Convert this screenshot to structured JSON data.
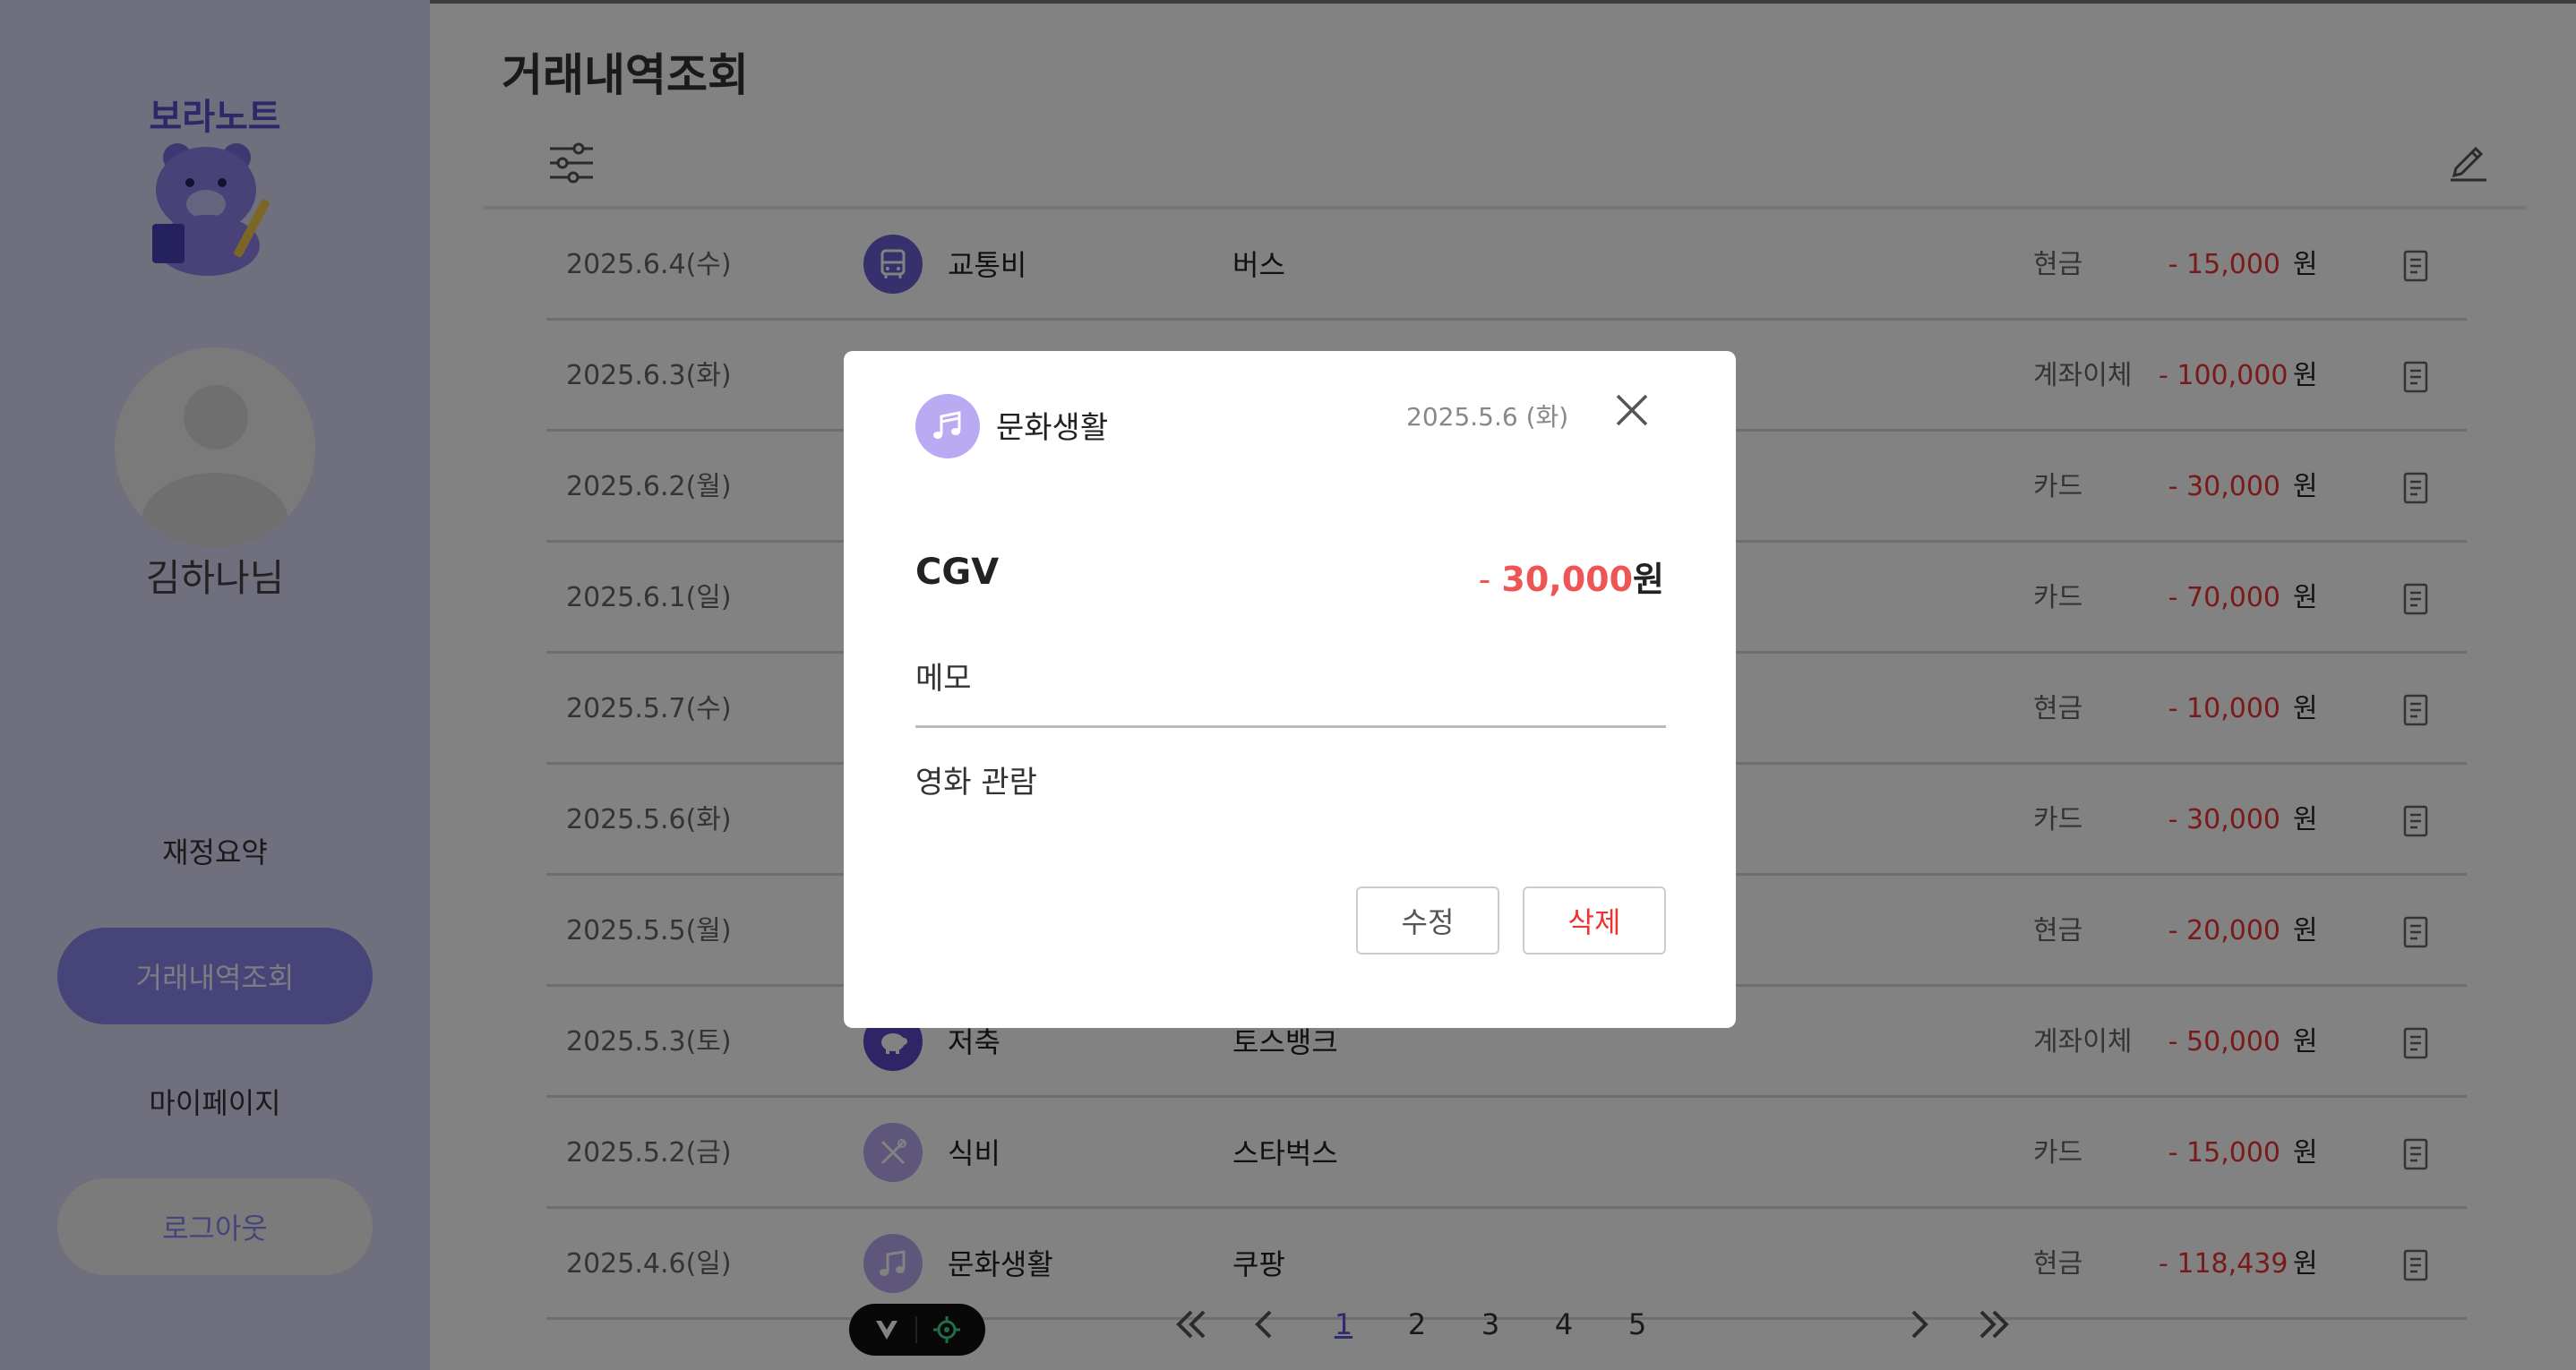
{
  "colors": {
    "accent": "#8c86f0",
    "sidebar_bg": "#dcdaf8",
    "expense_red": "#e33",
    "category_dark": "#6b5fd6",
    "category_darker": "#5a48c8",
    "category_light": "#b9aaf2"
  },
  "sidebar": {
    "logo_text": "보라노트",
    "user_name": "김하나님",
    "nav": {
      "summary": "재정요약",
      "transactions": "거래내역조회",
      "mypage": "마이페이지",
      "logout": "로그아웃"
    }
  },
  "page": {
    "title": "거래내역조회"
  },
  "transactions": [
    {
      "date": "2025.6.4(수)",
      "category": "교통비",
      "category_icon": "bus-icon",
      "merchant": "버스",
      "method": "현금",
      "amount": "- 15,000",
      "unit": "원"
    },
    {
      "date": "2025.6.3(화)",
      "category": "",
      "category_icon": "",
      "merchant": "",
      "method": "계좌이체",
      "amount": "- 100,000",
      "unit": "원"
    },
    {
      "date": "2025.6.2(월)",
      "category": "",
      "category_icon": "",
      "merchant": "",
      "method": "카드",
      "amount": "- 30,000",
      "unit": "원"
    },
    {
      "date": "2025.6.1(일)",
      "category": "",
      "category_icon": "",
      "merchant": "",
      "method": "카드",
      "amount": "- 70,000",
      "unit": "원"
    },
    {
      "date": "2025.5.7(수)",
      "category": "",
      "category_icon": "",
      "merchant": "",
      "method": "현금",
      "amount": "- 10,000",
      "unit": "원"
    },
    {
      "date": "2025.5.6(화)",
      "category": "",
      "category_icon": "",
      "merchant": "",
      "method": "카드",
      "amount": "- 30,000",
      "unit": "원"
    },
    {
      "date": "2025.5.5(월)",
      "category": "",
      "category_icon": "",
      "merchant": "",
      "method": "현금",
      "amount": "- 20,000",
      "unit": "원"
    },
    {
      "date": "2025.5.3(토)",
      "category": "저축",
      "category_icon": "piggy-bank-icon",
      "merchant": "토스뱅크",
      "method": "계좌이체",
      "amount": "- 50,000",
      "unit": "원"
    },
    {
      "date": "2025.5.2(금)",
      "category": "식비",
      "category_icon": "utensils-icon",
      "merchant": "스타벅스",
      "method": "카드",
      "amount": "- 15,000",
      "unit": "원"
    },
    {
      "date": "2025.4.6(일)",
      "category": "문화생활",
      "category_icon": "music-note-icon",
      "merchant": "쿠팡",
      "method": "현금",
      "amount": "- 118,439",
      "unit": "원"
    }
  ],
  "pagination": {
    "pages": [
      "1",
      "2",
      "3",
      "4",
      "5"
    ],
    "current": "1"
  },
  "modal": {
    "category": "문화생활",
    "category_icon": "music-note-icon",
    "date": "2025.5.6 (화)",
    "title": "CGV",
    "amount_sign": "-",
    "amount_value": "30,000",
    "amount_unit": "원",
    "memo_label": "메모",
    "memo_text": "영화 관람",
    "edit_label": "수정",
    "delete_label": "삭제"
  }
}
